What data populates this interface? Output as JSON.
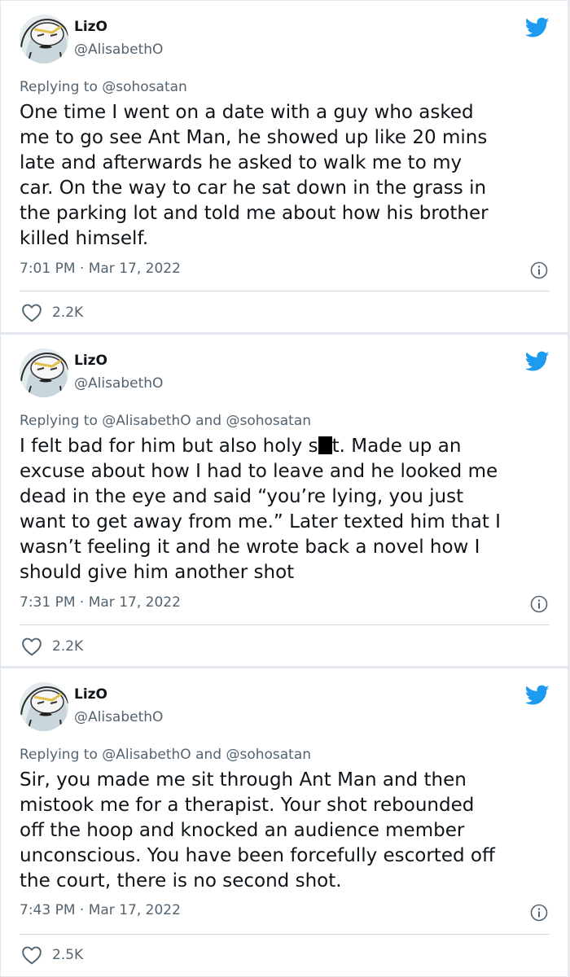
{
  "colors": {
    "accent": "#1d9bf0",
    "text": "#0f1419",
    "secondary": "#536471",
    "divider": "#cfd9de"
  },
  "icons": {
    "bird": "twitter-bird-icon",
    "info": "info-icon",
    "like": "heart-icon"
  },
  "tweets": [
    {
      "name": "LizO",
      "handle": "@AlisabethO",
      "replying_prefix": "Replying to",
      "replying_to": "@sohosatan",
      "lines": [
        "One time I went on a date with a guy who asked",
        "me to go see Ant Man, he showed up like 20 mins",
        "late and afterwards he asked to walk me to my",
        "car. On the way to car he sat down in the grass in",
        "the parking lot and told me about how his brother",
        "killed himself."
      ],
      "timestamp": "7:01 PM · Mar 17, 2022",
      "likes": "2.2K"
    },
    {
      "name": "LizO",
      "handle": "@AlisabethO",
      "replying_prefix": "Replying to",
      "replying_to": "@AlisabethO and @sohosatan",
      "line1_before": "I felt bad for him but also holy s",
      "line1_after": "t. Made up an",
      "lines": [
        "excuse about how I had to leave and he looked me",
        "dead in the eye and said “you’re lying, you just",
        "want to get away from me.” Later texted him that I",
        "wasn’t feeling it and he wrote back a novel how I",
        "should give him another shot"
      ],
      "timestamp": "7:31 PM · Mar 17, 2022",
      "likes": "2.2K"
    },
    {
      "name": "LizO",
      "handle": "@AlisabethO",
      "replying_prefix": "Replying to",
      "replying_to": "@AlisabethO and @sohosatan",
      "lines": [
        "Sir, you made me sit through Ant Man and then",
        "mistook me for a therapist. Your shot rebounded",
        "off the hoop and knocked an audience member",
        "unconscious. You have been forcefully escorted off",
        "the court, there is no second shot."
      ],
      "timestamp": "7:43 PM · Mar 17, 2022",
      "likes": "2.5K"
    }
  ]
}
